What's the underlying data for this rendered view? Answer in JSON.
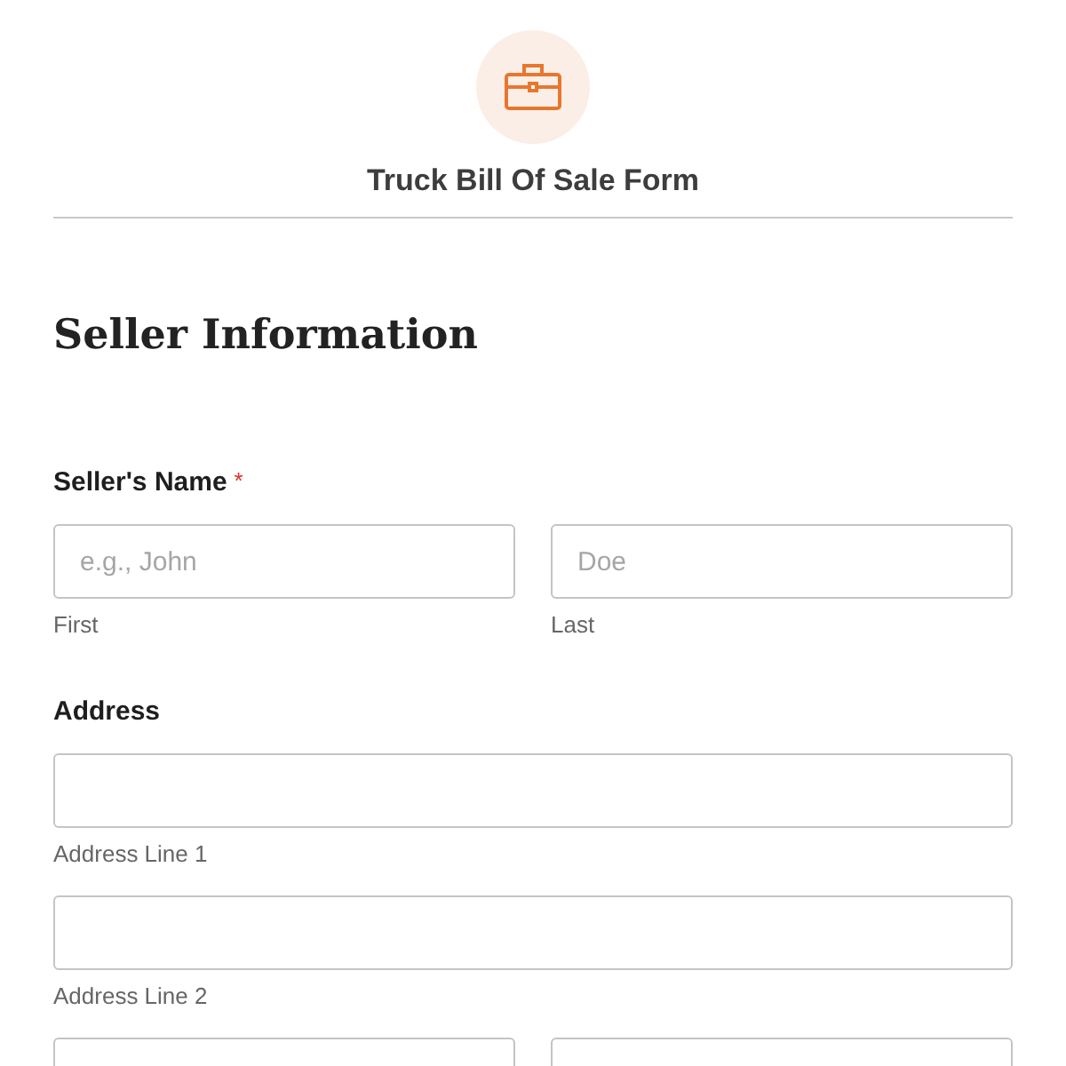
{
  "header": {
    "title": "Truck Bill Of Sale Form"
  },
  "section": {
    "heading": "Seller Information",
    "fields": [
      {
        "label": "Seller's Name",
        "required_mark": "*",
        "rows": [
          [
            {
              "placeholder": "e.g., John",
              "sublabel": "First"
            },
            {
              "placeholder": "Doe",
              "sublabel": "Last"
            }
          ]
        ]
      },
      {
        "label": "Address",
        "rows": [
          [
            {
              "sublabel": "Address Line 1"
            }
          ],
          [
            {
              "sublabel": "Address Line 2"
            }
          ],
          [
            {},
            {}
          ]
        ]
      }
    ]
  }
}
